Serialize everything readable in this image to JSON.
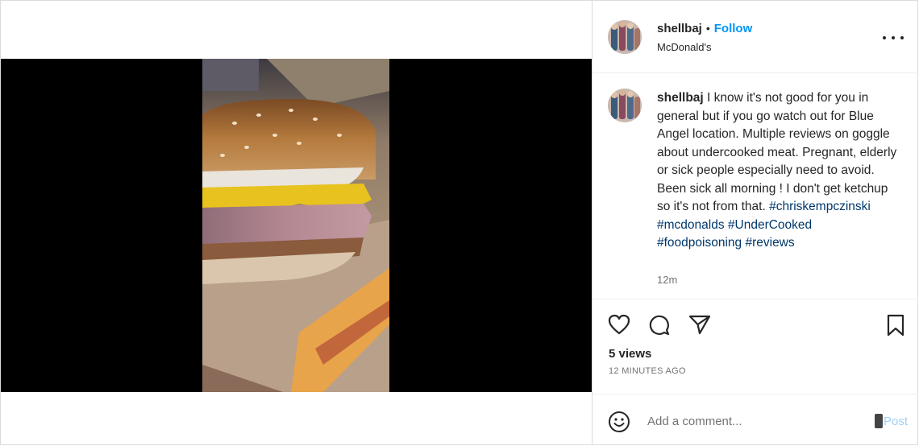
{
  "post": {
    "username": "shellbaj",
    "separator": "•",
    "follow_label": "Follow",
    "location": "McDonald's"
  },
  "caption": {
    "username": "shellbaj",
    "text": "I know it's not good for you in general but if you go watch out for Blue Angel location. Multiple reviews on goggle about undercooked meat. Pregnant, elderly or sick people especially need to avoid. Been sick all morning ! I don't get ketchup so it's not from that.",
    "hashtags": [
      "#chriskempczinski",
      "#mcdonalds",
      "#UnderCooked",
      "#foodpoisoning",
      "#reviews"
    ],
    "time": "12m"
  },
  "stats": {
    "views": "5 views",
    "posted_ago": "12 MINUTES AGO"
  },
  "comment": {
    "placeholder": "Add a comment...",
    "post_label": "Post"
  },
  "colors": {
    "accent": "#0095f6",
    "hashtag": "#00376b",
    "post_disabled": "#9fd0f7",
    "video_bg": "#000000"
  },
  "icons": [
    "like-icon",
    "comment-icon",
    "share-icon",
    "save-icon",
    "emoji-icon",
    "more-options-icon",
    "muted-speaker-icon"
  ]
}
